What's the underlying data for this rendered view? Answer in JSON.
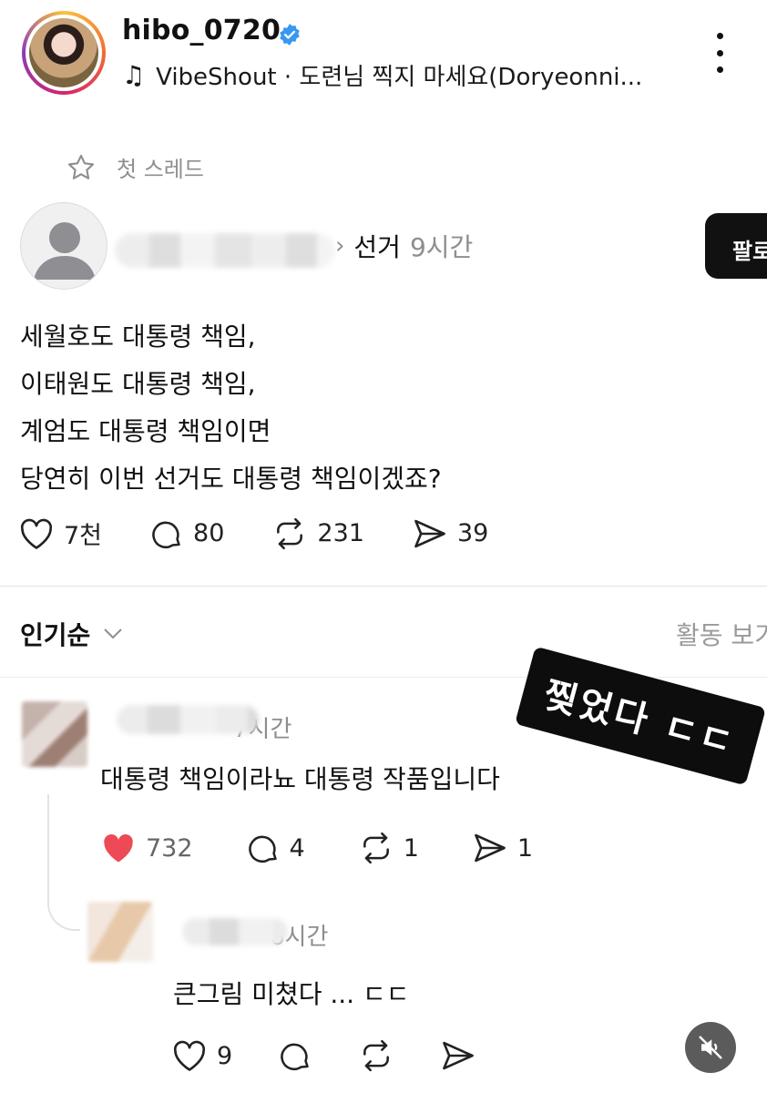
{
  "profile": {
    "username": "hibo_0720",
    "music": "VibeShout · 도련님 찍지 마세요(Doryeonni..."
  },
  "first_thread": {
    "label": "첫 스레드"
  },
  "post": {
    "topic": "선거",
    "time": "9시간",
    "follow_label": "팔로",
    "lines": [
      "세월호도 대통령 책임,",
      "이태원도 대통령 책임,",
      "계엄도 대통령 책임이면",
      "당연히 이번 선거도 대통령 책임이겠죠?"
    ],
    "likes": "7천",
    "comments": "80",
    "reposts": "231",
    "shares": "39"
  },
  "sort": {
    "label": "인기순",
    "activity_label": "활동 보기"
  },
  "sticker": {
    "text": "찢었다 ㄷㄷ"
  },
  "comments": [
    {
      "time": "7시간",
      "text": "대통령 책임이라뇨 대통령 작품입니다",
      "likes": "732",
      "replies": "4",
      "reposts": "1",
      "shares": "1"
    },
    {
      "time": "6시간",
      "text": "큰그림 미쳤다 ... ㄷㄷ",
      "likes": "9"
    }
  ],
  "colors": {
    "verified": "#3897f0",
    "liked": "#ed4956",
    "muted_text": "#8e8e8e"
  },
  "icons": [
    "verified-badge-icon",
    "music-note-icon",
    "more-icon",
    "star-icon",
    "heart-icon",
    "comment-icon",
    "repost-icon",
    "share-icon",
    "chevron-down-icon",
    "mute-icon"
  ]
}
